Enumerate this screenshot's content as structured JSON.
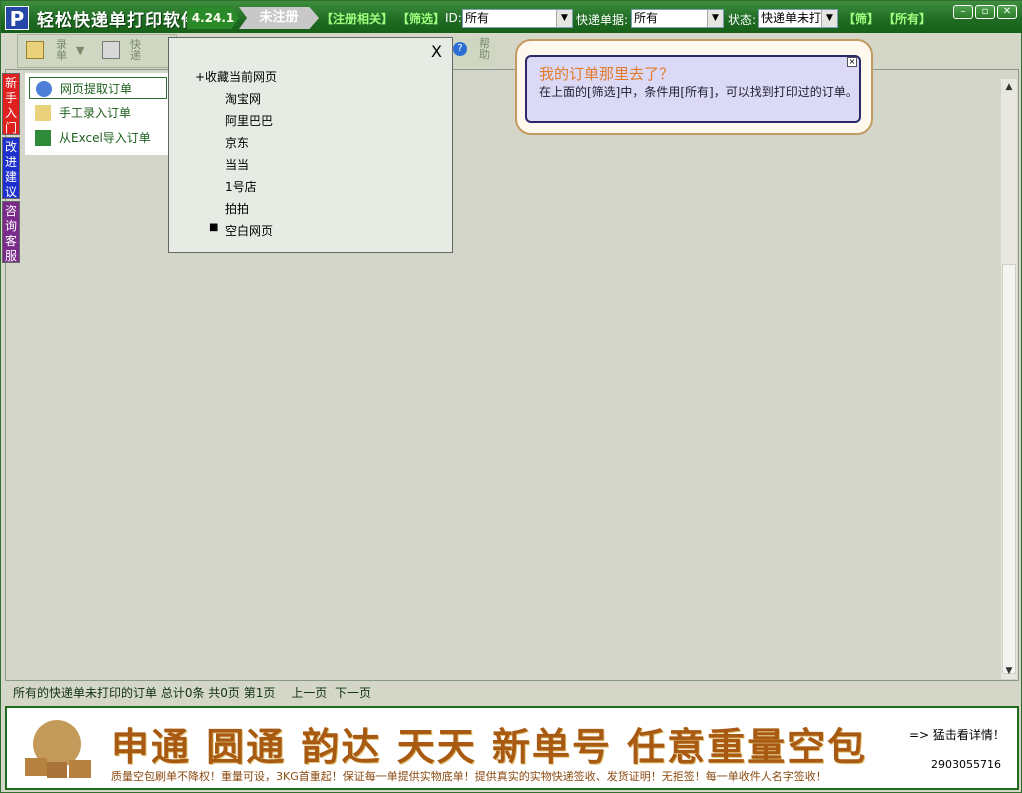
{
  "titlebar": {
    "logo": "P",
    "app_title": "轻松快递单打印软件",
    "version": "4.24.1",
    "unregistered": "未注册",
    "reg_link": "【注册相关】",
    "filter_link": "【筛选】",
    "id_label": "ID:",
    "id_value": "所有",
    "waybill_label": "快递单据:",
    "waybill_value": "所有",
    "status_label": "状态:",
    "status_value": "快递单未打",
    "filter_btn": "【筛】",
    "all_btn": "【所有】"
  },
  "toolbar": {
    "record_label": "录单",
    "express_label": "快递",
    "help_label": "帮助",
    "chevron": "▼"
  },
  "vtabs": [
    {
      "label": "新手入门",
      "color": "#e0201e"
    },
    {
      "label": "改进建议",
      "color": "#1e2fd0"
    },
    {
      "label": "咨询客服",
      "color": "#7a2a8a"
    }
  ],
  "sidemenu": {
    "items": [
      "网页提取订单",
      "手工录入订单",
      "从Excel导入订单"
    ]
  },
  "popup": {
    "close": "X",
    "header": "+收藏当前网页",
    "items": [
      "淘宝网",
      "阿里巴巴",
      "京东",
      "当当",
      "1号店",
      "拍拍"
    ],
    "selected_mark": "■",
    "selected": "空白网页"
  },
  "bubble": {
    "title": "我的订单那里去了？",
    "text": "在上面的[筛选]中，条件用[所有]，可以找到打印过的订单。",
    "close": "×"
  },
  "statusbar": {
    "text": "所有的快递单未打印的订单 总计0条 共0页 第1页",
    "prev": "上一页",
    "next": "下一页"
  },
  "banner": {
    "headline": "申通 圆通 韵达 天天 新单号 任意重量空包",
    "sub": "质量空包刷单不降权！重量可设，3KG首重起！保证每一单提供实物底单！提供真实的实物快递签收、发货证明！无拒签！每一单收件人名字签收！",
    "more": "=> 猛击看详情！",
    "qq": "2903055716"
  }
}
